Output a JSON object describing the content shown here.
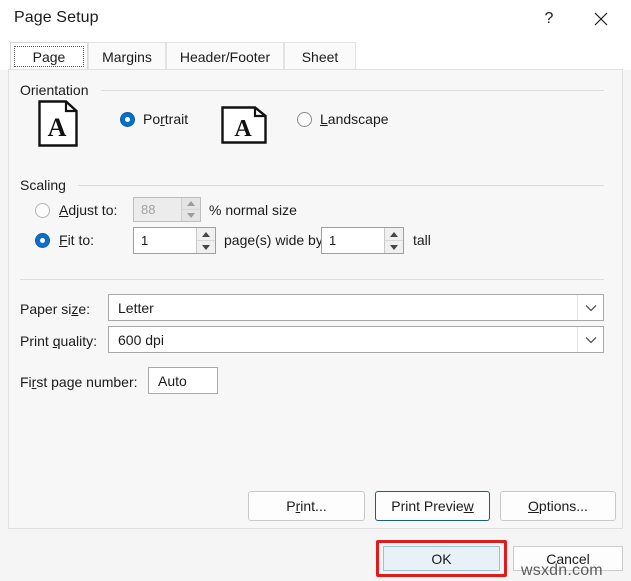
{
  "window": {
    "title": "Page Setup",
    "help_icon": "help-question-icon",
    "help_glyph": "?",
    "close_icon": "close-x-icon"
  },
  "tabs": [
    {
      "label": "Page",
      "active": true
    },
    {
      "label": "Margins",
      "active": false
    },
    {
      "label": "Header/Footer",
      "active": false
    },
    {
      "label": "Sheet",
      "active": false
    }
  ],
  "orientation": {
    "group_label": "Orientation",
    "portrait": {
      "label_pre": "Po",
      "label_accel": "r",
      "label_post": "trait",
      "selected": true,
      "icon": "portrait-page-icon"
    },
    "landscape": {
      "label_pre": "",
      "label_accel": "L",
      "label_post": "andscape",
      "selected": false,
      "icon": "landscape-page-icon"
    }
  },
  "scaling": {
    "group_label": "Scaling",
    "adjust": {
      "label_pre": "",
      "label_accel": "A",
      "label_post": "djust to:",
      "selected": false,
      "disabled": true,
      "value": "88",
      "suffix": "% normal size"
    },
    "fit": {
      "label_pre": "",
      "label_accel": "F",
      "label_post": "it to:",
      "selected": true,
      "disabled": false,
      "wide_value": "1",
      "mid_text": "page(s) wide by",
      "tall_value": "1",
      "tall_text": "tall"
    }
  },
  "paper_size": {
    "label_pre": "Paper si",
    "label_accel": "z",
    "label_post": "e:",
    "value": "Letter",
    "arrow_icon": "chevron-down-icon"
  },
  "print_quality": {
    "label_pre": "Print ",
    "label_accel": "q",
    "label_post": "uality:",
    "value": "600 dpi",
    "arrow_icon": "chevron-down-icon"
  },
  "first_page_number": {
    "label_pre": "Fi",
    "label_accel": "r",
    "label_post": "st page number:",
    "value": "Auto"
  },
  "buttons": {
    "print": {
      "pre": "P",
      "accel": "r",
      "post": "int..."
    },
    "print_preview": {
      "pre": "Print Previe",
      "accel": "w",
      "post": ""
    },
    "options": {
      "pre": "",
      "accel": "O",
      "post": "ptions..."
    },
    "ok": "OK",
    "cancel": "Cancel"
  },
  "annotation": {
    "highlight_color": "#e01b1b",
    "highlight_target": "ok-button"
  },
  "watermark": {
    "text": "wsxdn.com"
  }
}
